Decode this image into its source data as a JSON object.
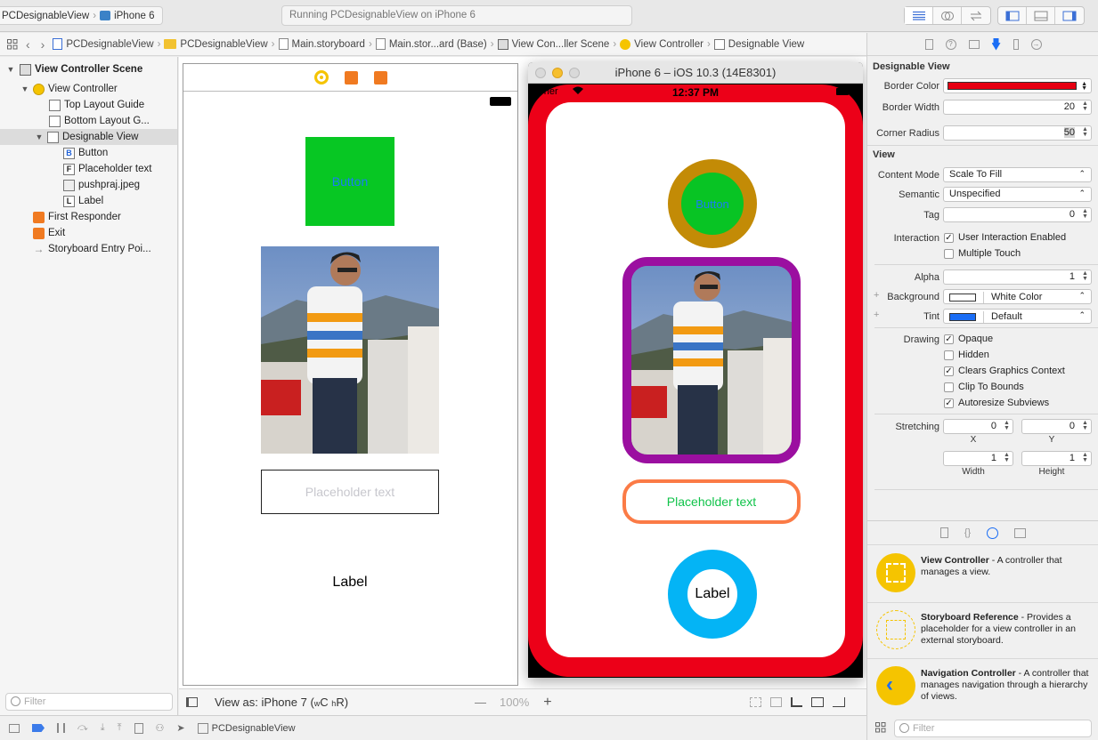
{
  "toolbar": {
    "scheme_name": "PCDesignableView",
    "scheme_device": "iPhone 6",
    "status": "Running PCDesignableView on iPhone 6"
  },
  "jumpbar": {
    "items": [
      "PCDesignableView",
      "PCDesignableView",
      "Main.storyboard",
      "Main.stor...ard (Base)",
      "View Con...ller Scene",
      "View Controller",
      "Designable View"
    ]
  },
  "navigator": {
    "rows": [
      {
        "label": "View Controller Scene",
        "bold": true
      },
      {
        "label": "View Controller"
      },
      {
        "label": "Top Layout Guide"
      },
      {
        "label": "Bottom Layout G..."
      },
      {
        "label": "Designable View",
        "selected": true
      },
      {
        "label": "Button",
        "icon_letter": "B"
      },
      {
        "label": "Placeholder text",
        "icon_letter": "F"
      },
      {
        "label": "pushpraj.jpeg"
      },
      {
        "label": "Label",
        "icon_letter": "L"
      },
      {
        "label": "First Responder"
      },
      {
        "label": "Exit"
      },
      {
        "label": "Storyboard Entry Poi..."
      }
    ],
    "filter_placeholder": "Filter"
  },
  "scene": {
    "button_label": "Button",
    "placeholder": "Placeholder text",
    "label": "Label"
  },
  "simulator": {
    "title": "iPhone 6 – iOS 10.3 (14E8301)",
    "carrier": "Carrier",
    "time": "12:37 PM",
    "button_label": "Button",
    "placeholder": "Placeholder text",
    "label": "Label",
    "colors": {
      "border_red": "#ec0018",
      "button_ring": "#c38b06",
      "button_fill": "#08c424",
      "image_border": "#9b0fa0",
      "field_border": "#fb7b46",
      "label_ring": "#04b4f5"
    }
  },
  "canvas_bottom": {
    "view_as": "View as: iPhone 7 (",
    "size_class_w": "w",
    "size_class_w2": "C",
    "size_class_h": "h",
    "size_class_h2": "R",
    "close_paren": ")",
    "zoom": "100%",
    "minus": "—",
    "plus": "+"
  },
  "debug": {
    "target": "PCDesignableView"
  },
  "inspector": {
    "section_designable": "Designable View",
    "border_color_label": "Border Color",
    "border_width_label": "Border Width",
    "border_width_value": "20",
    "corner_radius_label": "Corner Radius",
    "corner_radius_value": "50",
    "section_view": "View",
    "content_mode_label": "Content Mode",
    "content_mode_value": "Scale To Fill",
    "semantic_label": "Semantic",
    "semantic_value": "Unspecified",
    "tag_label": "Tag",
    "tag_value": "0",
    "interaction_label": "Interaction",
    "user_interaction": "User Interaction Enabled",
    "multiple_touch": "Multiple Touch",
    "alpha_label": "Alpha",
    "alpha_value": "1",
    "background_label": "Background",
    "background_value": "White Color",
    "tint_label": "Tint",
    "tint_value": "Default",
    "drawing_label": "Drawing",
    "opaque": "Opaque",
    "hidden": "Hidden",
    "clears_graphics": "Clears Graphics Context",
    "clip_to_bounds": "Clip To Bounds",
    "autoresize": "Autoresize Subviews",
    "stretching_label": "Stretching",
    "stretch_x": "0",
    "stretch_y": "0",
    "stretch_w": "1",
    "stretch_h": "1",
    "x_label": "X",
    "y_label": "Y",
    "width_label": "Width",
    "height_label": "Height",
    "border_color_hex": "#e60012",
    "tint_hex": "#1a6df5",
    "library": [
      {
        "title": "View Controller",
        "desc": " - A controller that manages a view."
      },
      {
        "title": "Storyboard Reference",
        "desc": " - Provides a placeholder for a view controller in an external storyboard."
      },
      {
        "title": "Navigation Controller",
        "desc": " - A controller that manages navigation through a hierarchy of views."
      }
    ],
    "filter_placeholder": "Filter"
  }
}
